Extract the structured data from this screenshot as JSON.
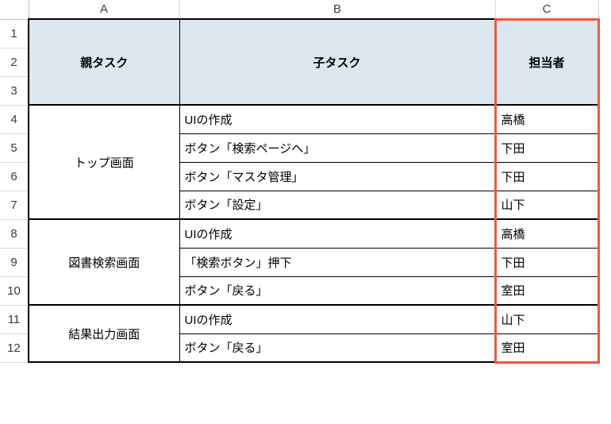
{
  "columns": {
    "A": "A",
    "B": "B",
    "C": "C"
  },
  "rows": [
    "1",
    "2",
    "3",
    "4",
    "5",
    "6",
    "7",
    "8",
    "9",
    "10",
    "11",
    "12"
  ],
  "header": {
    "parent": "親タスク",
    "child": "子タスク",
    "owner": "担当者"
  },
  "groups": [
    {
      "parent": "トップ画面",
      "rows": [
        {
          "child": "UIの作成",
          "owner": "高橋"
        },
        {
          "child": "ボタン「検索ページへ」",
          "owner": "下田"
        },
        {
          "child": "ボタン「マスタ管理」",
          "owner": "下田"
        },
        {
          "child": "ボタン「設定」",
          "owner": "山下"
        }
      ]
    },
    {
      "parent": "図書検索画面",
      "rows": [
        {
          "child": "UIの作成",
          "owner": "高橋"
        },
        {
          "child": "「検索ボタン」押下",
          "owner": "下田"
        },
        {
          "child": "ボタン「戻る」",
          "owner": "室田"
        }
      ]
    },
    {
      "parent": "結果出力画面",
      "rows": [
        {
          "child": "UIの作成",
          "owner": "山下"
        },
        {
          "child": "ボタン「戻る」",
          "owner": "室田"
        }
      ]
    }
  ]
}
